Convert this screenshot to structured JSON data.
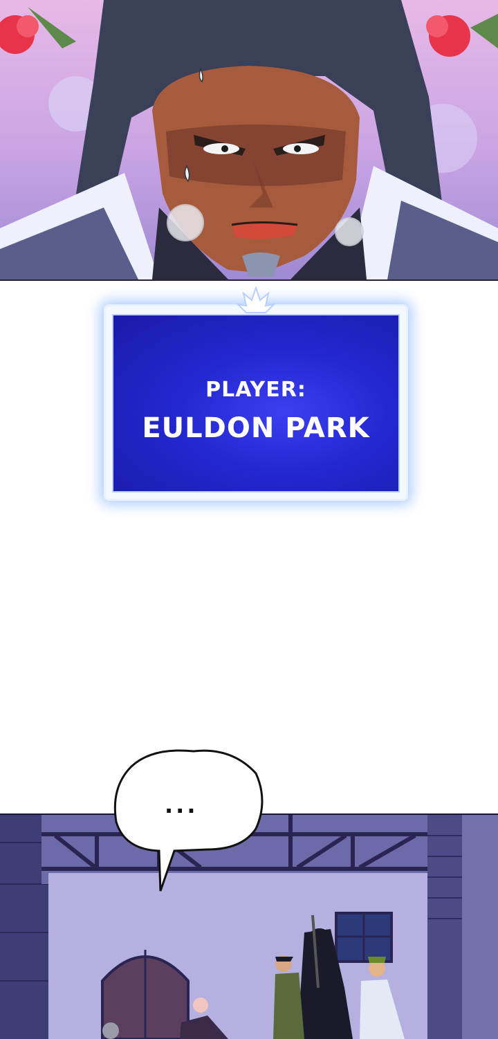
{
  "title_card": {
    "label": "PLAYER:",
    "name": "EULDON PARK"
  },
  "speech_bubble": {
    "text": "..."
  },
  "colors": {
    "card_blue": "#2327cf",
    "card_glow": "#96beff",
    "top_bg": "#e7b9e6",
    "night_bg": "#2c2864"
  }
}
